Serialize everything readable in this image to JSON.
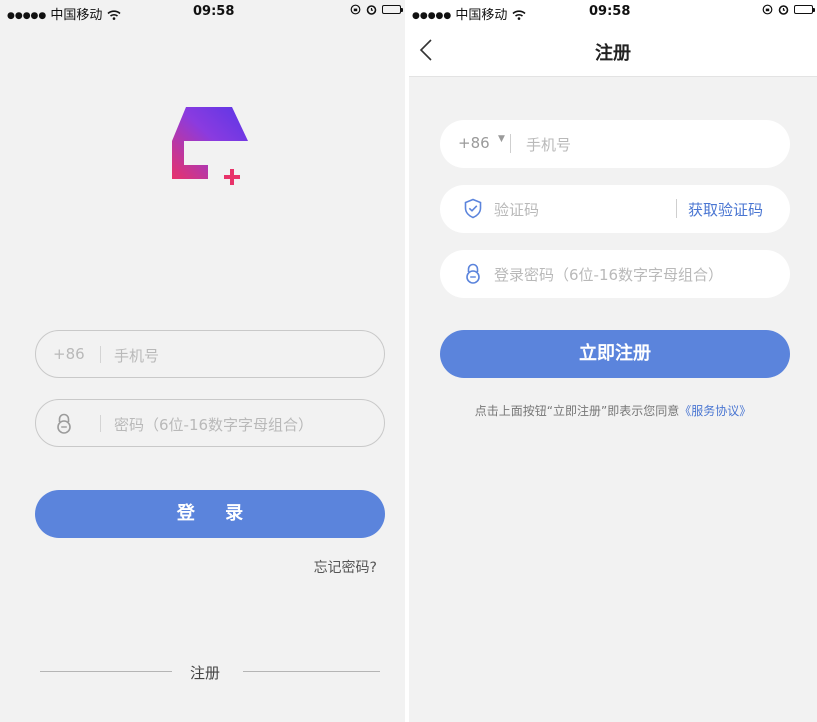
{
  "status_bar": {
    "carrier": "中国移动",
    "time": "09:58"
  },
  "login": {
    "phone_prefix": "+86",
    "phone_placeholder": "手机号",
    "password_placeholder": "密码（6位-16数字字母组合）",
    "login_button": "登 录",
    "forgot_password": "忘记密码?",
    "register_link": "注册"
  },
  "register": {
    "title": "注册",
    "phone_prefix": "+86",
    "phone_placeholder": "手机号",
    "code_placeholder": "验证码",
    "get_code_button": "获取验证码",
    "password_placeholder": "登录密码（6位-16数字字母组合）",
    "register_button": "立即注册",
    "terms_text": "点击上面按钮“立即注册”即表示您同意",
    "terms_link": "《服务协议》"
  },
  "colors": {
    "accent": "#5b84dc",
    "link": "#4a76d2",
    "background": "#f2f2f2"
  },
  "icons": [
    "wifi-icon",
    "alarm-icon",
    "lock-rotation-icon",
    "battery-icon",
    "app-logo-icon",
    "lock-icon",
    "shield-check-icon",
    "back-chevron-icon",
    "dropdown-caret-icon"
  ]
}
